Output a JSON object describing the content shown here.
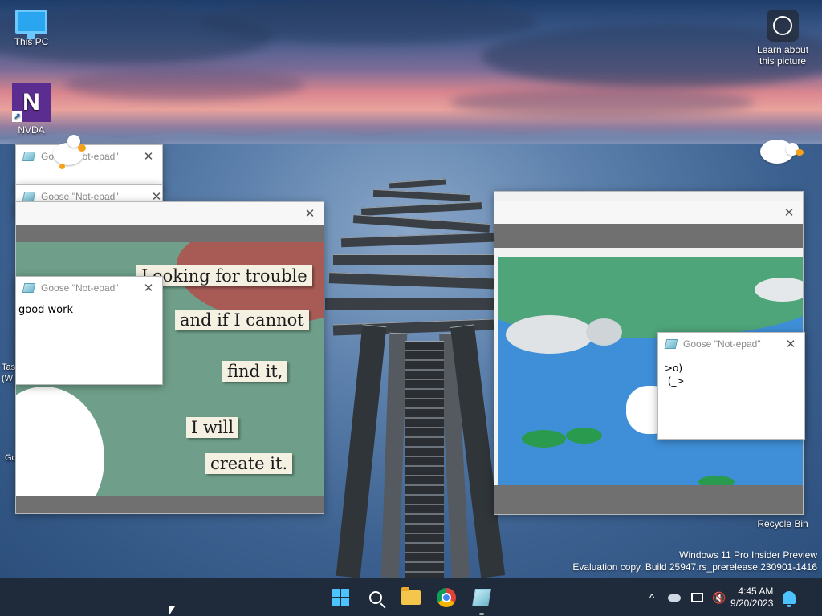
{
  "desktop": {
    "icons": {
      "this_pc": "This PC",
      "nvda": "NVDA",
      "learn_about": "Learn about this picture",
      "recycle_bin": "Recycle Bin"
    },
    "partial_labels": {
      "tas": "Tas",
      "w": "(W",
      "go": "Go"
    }
  },
  "windows": {
    "title": "Goose \"Not-epad\"",
    "good_work_text": "good work",
    "goose_ascii": ">o)\n (_>"
  },
  "meme": {
    "lines": [
      "Looking for trouble",
      "and if I cannot",
      "find it,",
      "I will",
      "create it."
    ]
  },
  "watermark": {
    "line1": "Windows 11 Pro Insider Preview",
    "line2": "Evaluation copy. Build 25947.rs_prerelease.230901-1416"
  },
  "taskbar": {
    "apps": [
      "start",
      "search",
      "file-explorer",
      "chrome",
      "goose-notepad"
    ],
    "time": "4:45 AM",
    "date": "9/20/2023",
    "chevron": "^"
  },
  "colors": {
    "taskbar_bg": "#1f2a3a",
    "accent": "#4cc2ff",
    "meme_bg": "#6f9f8a",
    "pond_blue": "#3f8fd8"
  }
}
